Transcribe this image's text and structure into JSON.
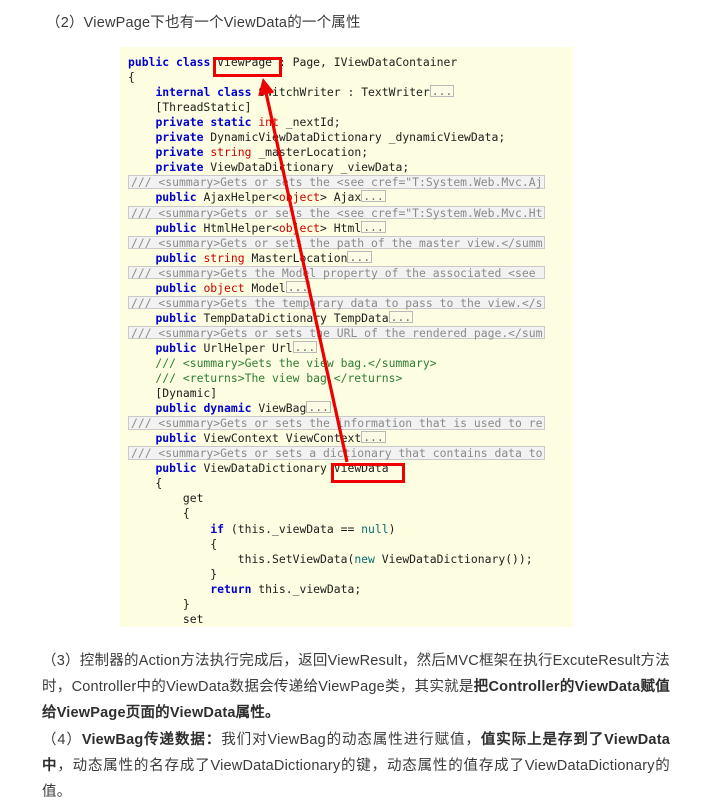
{
  "document": {
    "heading_2": "（2）ViewPage下也有一个ViewData的一个属性"
  },
  "code": {
    "language": "C#",
    "background_color": "#fdfde2",
    "lines": [
      {
        "id": "l0",
        "kind": "partial-top",
        "text": ""
      },
      {
        "id": "l1",
        "kind": "code",
        "text": "public class ViewPage : Page, IViewDataContainer"
      },
      {
        "id": "l2",
        "kind": "code",
        "text": "{"
      },
      {
        "id": "l3",
        "kind": "collapsed",
        "text": "    internal class SwitchWriter : TextWriter"
      },
      {
        "id": "l4",
        "kind": "code",
        "text": "    [ThreadStatic]"
      },
      {
        "id": "l5",
        "kind": "code",
        "text": "    private static int _nextId;"
      },
      {
        "id": "l6",
        "kind": "code",
        "text": "    private DynamicViewDataDictionary _dynamicViewData;"
      },
      {
        "id": "l7",
        "kind": "code",
        "text": "    private string _masterLocation;"
      },
      {
        "id": "l8",
        "kind": "code",
        "text": "    private ViewDataDictionary _viewData;"
      },
      {
        "id": "l9",
        "kind": "summary",
        "text": "    /// <summary>Gets or sets the <see cref=\"T:System.Web.Mvc.Aj"
      },
      {
        "id": "l10",
        "kind": "collapsed",
        "text": "    public AjaxHelper<object> Ajax"
      },
      {
        "id": "l11",
        "kind": "summary",
        "text": "    /// <summary>Gets or sets the <see cref=\"T:System.Web.Mvc.Ht"
      },
      {
        "id": "l12",
        "kind": "collapsed",
        "text": "    public HtmlHelper<object> Html"
      },
      {
        "id": "l13",
        "kind": "summary",
        "text": "    /// <summary>Gets or sets the path of the master view.</summ"
      },
      {
        "id": "l14",
        "kind": "collapsed",
        "text": "    public string MasterLocation"
      },
      {
        "id": "l15",
        "kind": "summary",
        "text": "    /// <summary>Gets the Model property of the associated <see "
      },
      {
        "id": "l16",
        "kind": "collapsed",
        "text": "    public object Model"
      },
      {
        "id": "l17",
        "kind": "summary",
        "text": "    /// <summary>Gets the temporary data to pass to the view.</s"
      },
      {
        "id": "l18",
        "kind": "collapsed",
        "text": "    public TempDataDictionary TempData"
      },
      {
        "id": "l19",
        "kind": "summary",
        "text": "    /// <summary>Gets or sets the URL of the rendered page.</sum"
      },
      {
        "id": "l20",
        "kind": "collapsed",
        "text": "    public UrlHelper Url"
      },
      {
        "id": "l21",
        "kind": "comment",
        "text": "    /// <summary>Gets the view bag.</summary>"
      },
      {
        "id": "l22",
        "kind": "comment",
        "text": "    /// <returns>The view bag.</returns>"
      },
      {
        "id": "l23",
        "kind": "code",
        "text": "    [Dynamic]"
      },
      {
        "id": "l24",
        "kind": "collapsed",
        "text": "    public dynamic ViewBag"
      },
      {
        "id": "l25",
        "kind": "summary",
        "text": "    /// <summary>Gets or sets the information that is used to re"
      },
      {
        "id": "l26",
        "kind": "collapsed",
        "text": "    public ViewContext ViewContext"
      },
      {
        "id": "l27",
        "kind": "summary",
        "text": "    /// <summary>Gets or sets a dictionary that contains data to"
      },
      {
        "id": "l28",
        "kind": "code",
        "text": "    public ViewDataDictionary ViewData"
      },
      {
        "id": "l29",
        "kind": "code",
        "text": "    {"
      },
      {
        "id": "l30",
        "kind": "code",
        "text": "        get"
      },
      {
        "id": "l31",
        "kind": "code",
        "text": "        {"
      },
      {
        "id": "l32",
        "kind": "code",
        "text": "            if (this._viewData == null)"
      },
      {
        "id": "l33",
        "kind": "code",
        "text": "            {"
      },
      {
        "id": "l34",
        "kind": "code",
        "text": "                this.SetViewData(new ViewDataDictionary());"
      },
      {
        "id": "l35",
        "kind": "code",
        "text": "            }"
      },
      {
        "id": "l36",
        "kind": "code",
        "text": "            return this._viewData;"
      },
      {
        "id": "l37",
        "kind": "code",
        "text": "        }"
      },
      {
        "id": "l38",
        "kind": "code",
        "text": "        set"
      }
    ]
  },
  "annotations": {
    "color": "#ee0000",
    "highlight_viewpage": "ViewPage",
    "highlight_viewdata": "ViewData",
    "arrow": "red-arrow-from-viewdata-to-viewpage"
  },
  "paragraphs": {
    "p3": {
      "segments": [
        {
          "text": "（3）控制器的Action方法执行完成后，返回ViewResult，然后MVC框架在执行ExcuteResult方法时，Controller中的ViewData数据会传递给ViewPage类，其实就是",
          "bold": false
        },
        {
          "text": "把Controller的ViewData赋值给ViewPage页面的ViewData属性。",
          "bold": true
        }
      ]
    },
    "p4": {
      "segments": [
        {
          "text": "（4）",
          "bold": false
        },
        {
          "text": "ViewBag传递数据：",
          "bold": true
        },
        {
          "text": "我们对ViewBag的动态属性进行赋值，",
          "bold": false
        },
        {
          "text": "值实际上是存到了ViewData中",
          "bold": true
        },
        {
          "text": "，动态属性的名存成了ViewDataDictionary的键，动态属性的值存成了ViewDataDictionary的值。",
          "bold": false
        }
      ]
    }
  }
}
